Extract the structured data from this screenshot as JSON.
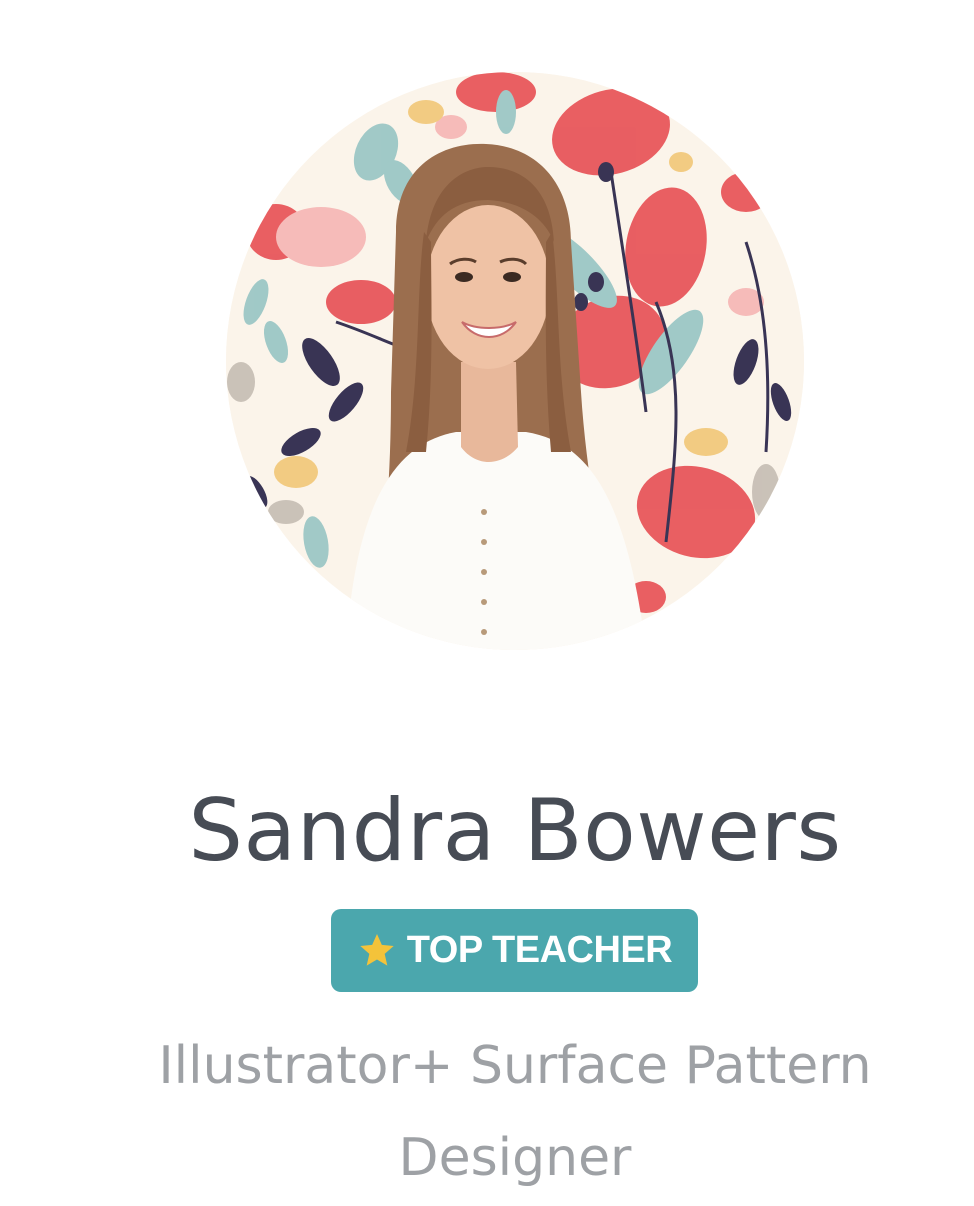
{
  "profile": {
    "name": "Sandra Bowers",
    "badge_label": "TOP TEACHER",
    "headline_line1": "Illustrator+ Surface Pattern",
    "headline_line2": "Designer"
  },
  "colors": {
    "name_text": "#474c55",
    "badge_bg": "#4ba7ad",
    "badge_text": "#ffffff",
    "star": "#f4c33a",
    "headline_text": "#9ea1a5"
  },
  "icons": {
    "badge_icon": "star-icon"
  }
}
